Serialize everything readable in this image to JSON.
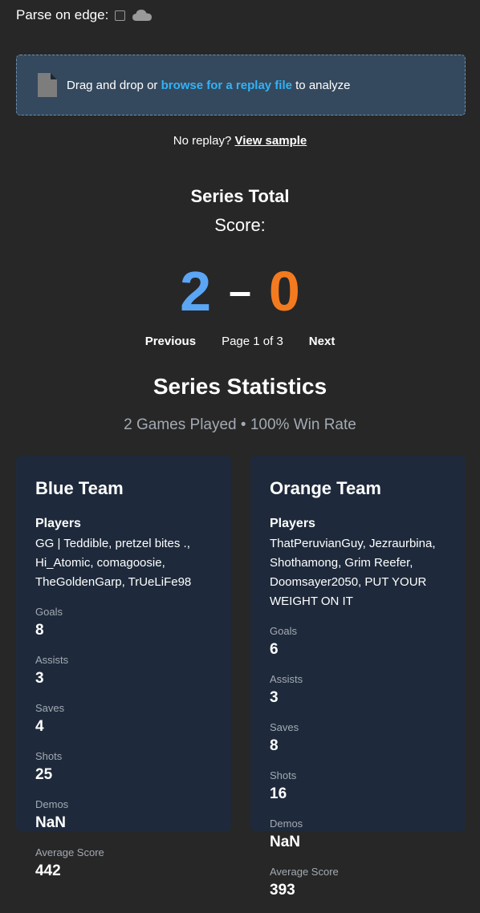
{
  "top": {
    "parse_label": "Parse on edge:"
  },
  "dropzone": {
    "prefix": "Drag and drop or ",
    "link": "browse for a replay file",
    "suffix": " to analyze"
  },
  "sample": {
    "prefix": "No replay? ",
    "link": "View sample"
  },
  "score": {
    "title": "Series Total",
    "label": "Score:",
    "blue": "2",
    "dash": "–",
    "orange": "0"
  },
  "pager": {
    "prev": "Previous",
    "page": "Page 1 of 3",
    "next": "Next"
  },
  "stats": {
    "title": "Series Statistics",
    "subtitle": "2 Games Played • 100% Win Rate"
  },
  "teams": {
    "blue": {
      "name": "Blue Team",
      "players_heading": "Players",
      "players": "GG | Teddible, pretzel bites ., Hi_Atomic, comagoosie, TheGoldenGarp, TrUeLiFe98",
      "goals_label": "Goals",
      "goals": "8",
      "assists_label": "Assists",
      "assists": "3",
      "saves_label": "Saves",
      "saves": "4",
      "shots_label": "Shots",
      "shots": "25",
      "demos_label": "Demos",
      "demos": "NaN",
      "avg_label": "Average Score",
      "avg": "442"
    },
    "orange": {
      "name": "Orange Team",
      "players_heading": "Players",
      "players": "ThatPeruvianGuy, Jezraurbina, Shothamong, Grim Reefer, Doomsayer2050, PUT YOUR WEIGHT ON IT",
      "goals_label": "Goals",
      "goals": "6",
      "assists_label": "Assists",
      "assists": "3",
      "saves_label": "Saves",
      "saves": "8",
      "shots_label": "Shots",
      "shots": "16",
      "demos_label": "Demos",
      "demos": "NaN",
      "avg_label": "Average Score",
      "avg": "393"
    }
  },
  "colors": {
    "background": "#272727",
    "dropzone": "#34495e",
    "link": "#33b2f5",
    "blue_score": "#5ba5f5",
    "orange_score": "#f47a1f",
    "card": "#1e2a3b",
    "muted": "#a3aab3"
  },
  "icons": [
    "checkbox-icon",
    "cloud-icon",
    "file-icon"
  ]
}
